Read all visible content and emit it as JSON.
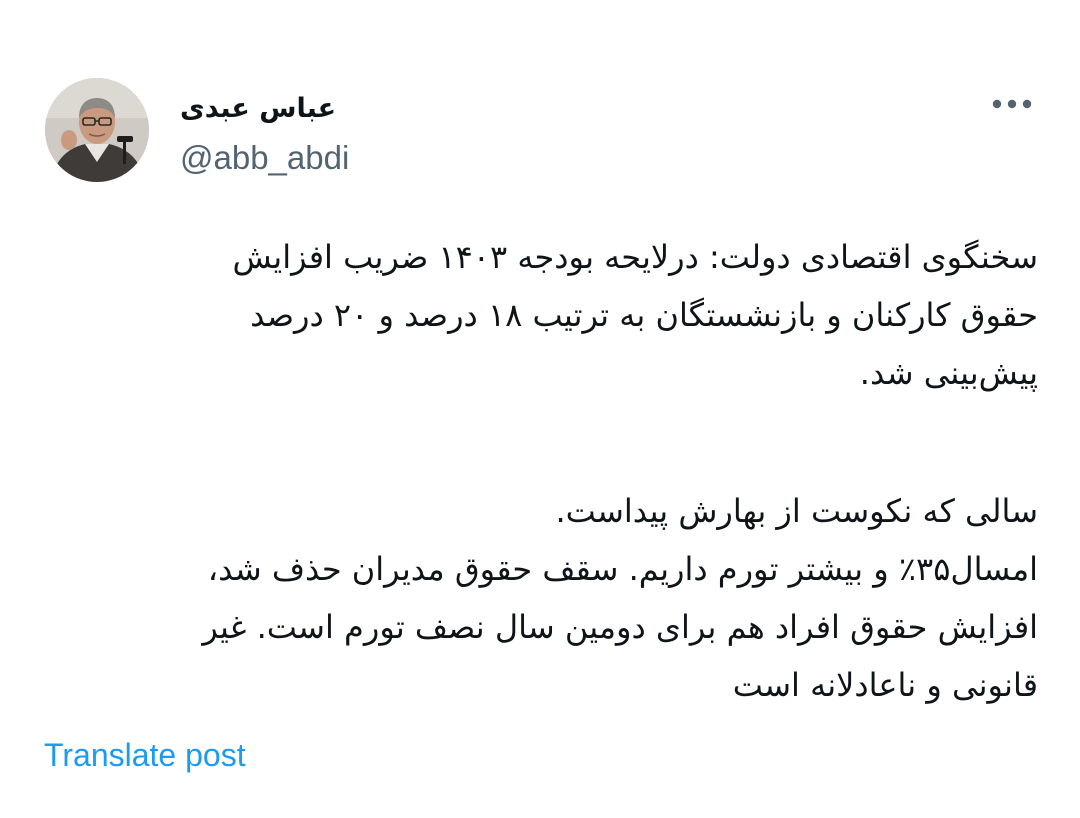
{
  "author": {
    "display_name": "عباس عبدی",
    "handle": "@abb_abdi",
    "avatar_icon": "profile-photo"
  },
  "menu": {
    "icon": "more-horizontal-icon"
  },
  "tweet": {
    "paragraph_1": [
      "سخنگوی اقتصادی دولت: درلایحه بودجه ۱۴۰۳ ضریب افزایش",
      "حقوق کارکنان و بازنشستگان به ترتیب ۱۸ درصد و ۲۰ درصد",
      "پیش‌بینی شد."
    ],
    "paragraph_2": [
      "سالی که نکوست از بهارش پیداست.",
      "امسال۳۵٪ و بیشتر تورم داریم. سقف حقوق مدیران حذف شد،",
      "افزایش حقوق افراد هم برای دومین سال نصف تورم است. غیر",
      "قانونی و ناعادلانه است"
    ]
  },
  "translate": {
    "label": "Translate post"
  },
  "colors": {
    "text": "#0f1419",
    "secondary": "#536471",
    "link": "#1d9bf0"
  }
}
